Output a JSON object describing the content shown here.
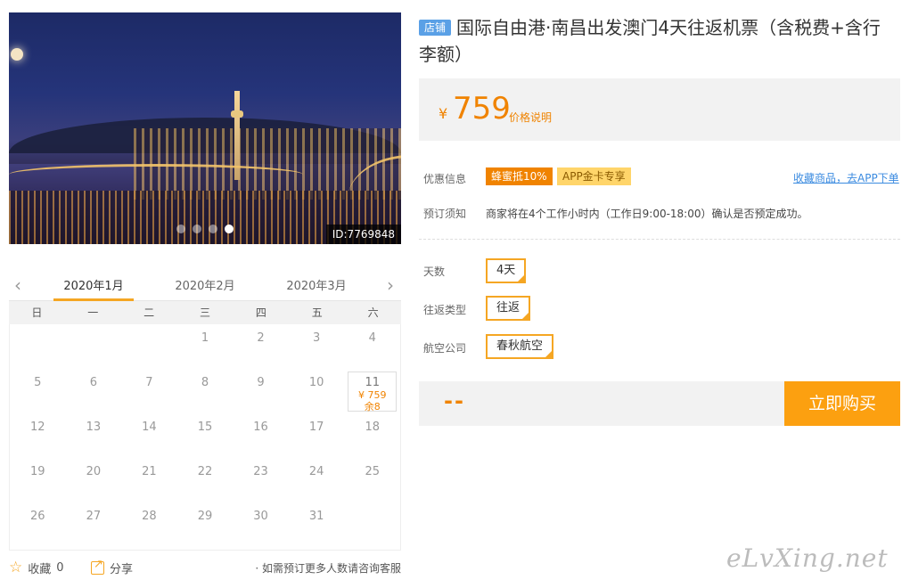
{
  "hero": {
    "id_label": "ID:7769848",
    "slides": 4,
    "active_slide": 4
  },
  "calendar": {
    "months": [
      "2020年1月",
      "2020年2月",
      "2020年3月"
    ],
    "weekdays": [
      "日",
      "一",
      "二",
      "三",
      "四",
      "五",
      "六"
    ],
    "dates": [
      "",
      "",
      "",
      "1",
      "2",
      "3",
      "4",
      "5",
      "6",
      "7",
      "8",
      "9",
      "10",
      "11",
      "12",
      "13",
      "14",
      "15",
      "16",
      "17",
      "18",
      "19",
      "20",
      "21",
      "22",
      "23",
      "24",
      "25",
      "26",
      "27",
      "28",
      "29",
      "30",
      "31",
      ""
    ],
    "available": {
      "date": "11",
      "price": "¥ 759",
      "stock": "余8"
    }
  },
  "actions": {
    "favorite": "收藏",
    "favorite_count": "0",
    "share": "分享",
    "note": "· 如需预订更多人数请咨询客服"
  },
  "product": {
    "badge": "店铺",
    "title": "国际自由港·南昌出发澳门4天往返机票（含税费+含行李额）",
    "currency": "¥",
    "price": "759",
    "price_explain": "价格说明"
  },
  "promo": {
    "label": "优惠信息",
    "tag1": "蜂蜜抵10%",
    "tag2": "APP金卡专享",
    "link": "收藏商品，去APP下单"
  },
  "booking": {
    "label": "预订须知",
    "text": "商家将在4个工作小时内（工作日9:00-18:00）确认是否预定成功。"
  },
  "options": {
    "days_label": "天数",
    "days": "4天",
    "trip_label": "往返类型",
    "trip": "往返",
    "airline_label": "航空公司",
    "airline": "春秋航空"
  },
  "buy": {
    "qty_placeholder": "--",
    "button": "立即购买"
  },
  "watermark": "eLvXing.net",
  "colors": {
    "accent": "#f08300",
    "button": "#fca010",
    "badge": "#5aa0e6",
    "link": "#3b8be0"
  }
}
